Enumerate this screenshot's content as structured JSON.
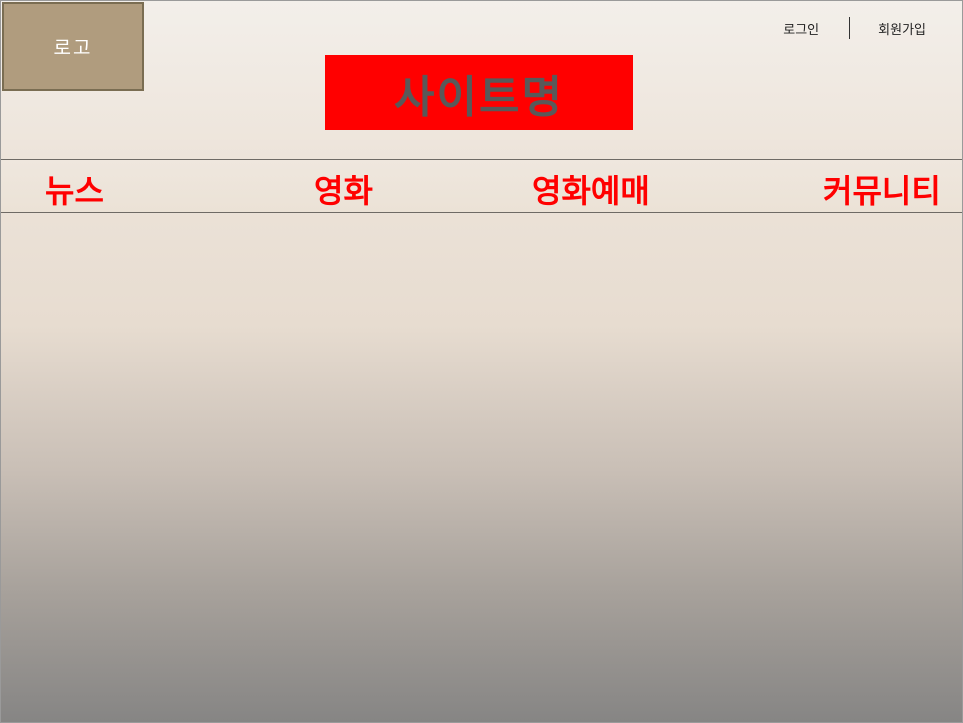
{
  "header": {
    "logo_label": "로고",
    "site_name": "사이트명",
    "login_label": "로그인",
    "signup_label": "회원가입"
  },
  "nav": {
    "items": [
      {
        "label": "뉴스"
      },
      {
        "label": "영화"
      },
      {
        "label": "영화예매"
      },
      {
        "label": "커뮤니티"
      }
    ]
  },
  "colors": {
    "logo_bg": "#b09c7e",
    "site_name_bg": "#ff0000",
    "site_name_text": "#595959",
    "nav_text": "#ff0000"
  }
}
